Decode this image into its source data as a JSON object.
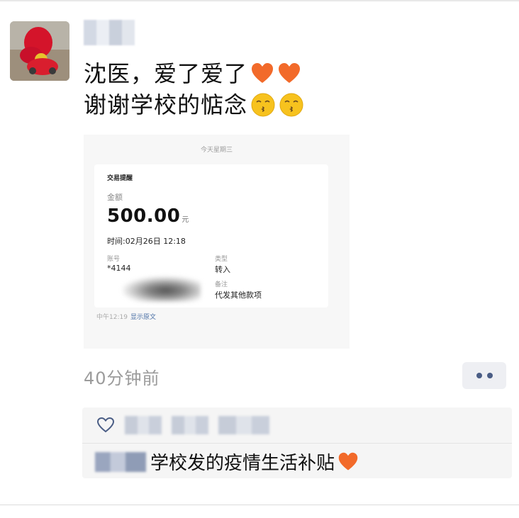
{
  "post": {
    "line1": "沈医，爱了爱了",
    "line2": "谢谢学校的惦念",
    "time": "40分钟前"
  },
  "screenshot": {
    "date_header": "今天星期三",
    "card_title": "交易提醒",
    "amount_label": "金额",
    "amount": "500.00",
    "amount_unit": "元",
    "time": "时间:02月26日 12:18",
    "account_label": "账号",
    "account_value": "*4144",
    "type_label": "类型",
    "type_value": "转入",
    "note_label": "备注",
    "note_value": "代发其他款项",
    "footer_time": "中午12:19",
    "footer_link": "显示原文"
  },
  "comment": {
    "text": "学校发的疫情生活补贴"
  },
  "colors": {
    "link": "#4a6fa5",
    "heart": "#f26a2a",
    "more_dots": "#4a5d85"
  }
}
